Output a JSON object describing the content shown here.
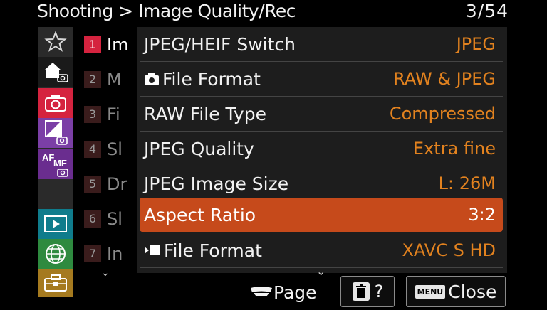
{
  "header": {
    "breadcrumb": "Shooting > Image Quality/Rec",
    "page_indicator": "3/54"
  },
  "sidebar": {
    "tabs": [
      {
        "name": "favorites",
        "icon": "star-icon"
      },
      {
        "name": "my-menu-home",
        "icon": "home-camera-icon"
      },
      {
        "name": "shooting",
        "icon": "camera-icon",
        "selected": true
      },
      {
        "name": "exposure",
        "icon": "exposure-icon"
      },
      {
        "name": "focus",
        "icon": "af-mf-icon"
      },
      {
        "name": "playback",
        "icon": "play-icon"
      },
      {
        "name": "network",
        "icon": "globe-icon"
      },
      {
        "name": "setup",
        "icon": "toolbox-icon"
      }
    ],
    "af_text": "AF",
    "mf_text": "MF"
  },
  "sections": [
    {
      "num": "1",
      "label": "Im",
      "active": true
    },
    {
      "num": "2",
      "label": "M"
    },
    {
      "num": "3",
      "label": "Fi"
    },
    {
      "num": "4",
      "label": "Sl"
    },
    {
      "num": "5",
      "label": "Dr"
    },
    {
      "num": "6",
      "label": "Sl"
    },
    {
      "num": "7",
      "label": "In"
    }
  ],
  "menu": {
    "items": [
      {
        "label": "JPEG/HEIF Switch",
        "value": "JPEG",
        "icon": ""
      },
      {
        "label": "File Format",
        "value": "RAW & JPEG",
        "icon": "still-camera-icon"
      },
      {
        "label": "RAW File Type",
        "value": "Compressed",
        "icon": ""
      },
      {
        "label": "JPEG Quality",
        "value": "Extra fine",
        "icon": ""
      },
      {
        "label": "JPEG Image Size",
        "value": "L: 26M",
        "icon": ""
      },
      {
        "label": "Aspect Ratio",
        "value": "3:2",
        "icon": "",
        "selected": true
      },
      {
        "label": "File Format",
        "value": "XAVC S HD",
        "icon": "movie-icon"
      }
    ]
  },
  "footer": {
    "page_label": "Page",
    "help_label": "?",
    "menu_tag": "MENU",
    "close_label": "Close"
  },
  "colors": {
    "selected_row": "#c64a1b",
    "value_text": "#e2821f",
    "shooting_tab": "#d5233f"
  }
}
